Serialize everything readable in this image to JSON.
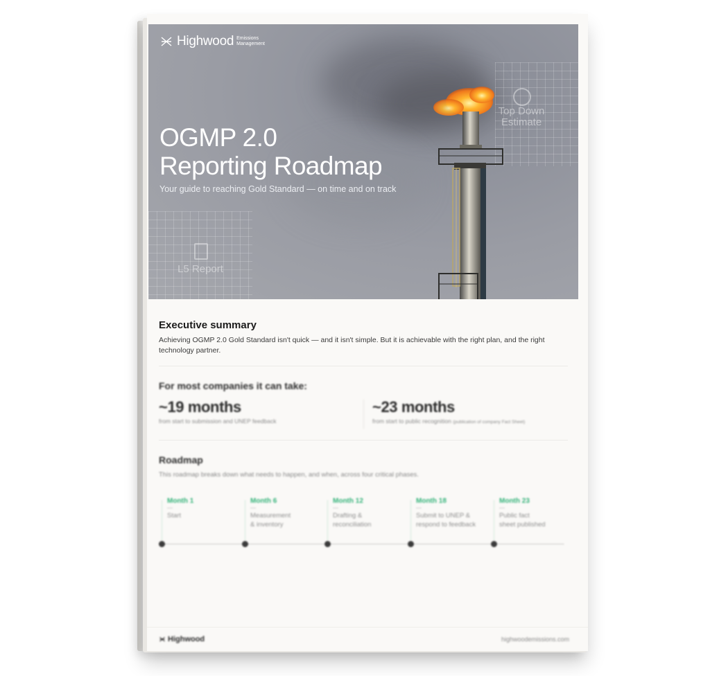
{
  "brand": {
    "name": "Highwood",
    "sub_line1": "Emissions",
    "sub_line2": "Management"
  },
  "hero": {
    "title_line1": "OGMP 2.0",
    "title_line2": "Reporting Roadmap",
    "subtitle": "Your guide to reaching Gold Standard — on time and on track",
    "deco_top_right": "Top Down Estimate",
    "deco_bottom_left": "L5 Report"
  },
  "summary": {
    "heading": "Executive summary",
    "body": "Achieving OGMP 2.0 Gold Standard isn't quick — and it isn't simple. But it is achievable with the right plan, and the right technology partner."
  },
  "durations": {
    "heading": "For most companies it can take:",
    "items": [
      {
        "value": "~19 months",
        "caption": "from start to submission and UNEP feedback",
        "caption_note": ""
      },
      {
        "value": "~23 months",
        "caption": "from start to public recognition",
        "caption_note": "(publication of company Fact Sheet)"
      }
    ]
  },
  "roadmap": {
    "heading": "Roadmap",
    "intro": "This roadmap breaks down what needs to happen, and when, across four critical phases.",
    "milestones": [
      {
        "month": "Month 1",
        "line1": "Start",
        "line2": ""
      },
      {
        "month": "Month 6",
        "line1": "Measurement",
        "line2": "& inventory"
      },
      {
        "month": "Month 12",
        "line1": "Drafting &",
        "line2": "reconciliation"
      },
      {
        "month": "Month 18",
        "line1": "Submit to UNEP &",
        "line2": "respond to feedback"
      },
      {
        "month": "Month 23",
        "line1": "Public fact",
        "line2": "sheet published"
      }
    ]
  },
  "footer": {
    "logo_text": "Highwood",
    "url": "highwoodemissions.com"
  },
  "colors": {
    "accent_green": "#34b37a",
    "flame_orange": "#f07a1c"
  }
}
